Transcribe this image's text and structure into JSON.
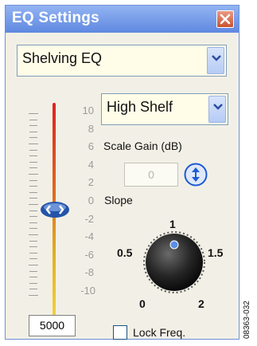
{
  "window": {
    "title": "EQ Settings",
    "close_icon": "close-icon"
  },
  "eq_type": {
    "value": "Shelving EQ"
  },
  "filter_type": {
    "value": "High Shelf"
  },
  "scale": {
    "labels": [
      "10",
      "8",
      "6",
      "4",
      "2",
      "0",
      "-2",
      "-4",
      "-6",
      "-8",
      "-10"
    ]
  },
  "frequency": {
    "value": "5000"
  },
  "scale_gain": {
    "label": "Scale Gain (dB)",
    "value": "0"
  },
  "slope": {
    "label": "Slope",
    "marks": {
      "top": "1",
      "left": "0.5",
      "right": "1.5",
      "bottom_left": "0",
      "bottom_right": "2"
    }
  },
  "lock_freq": {
    "label": "Lock Freq.",
    "checked": false
  },
  "figure_code": "08363-032",
  "colors": {
    "titlebar": "#5f88e0",
    "accent": "#1d5bd3",
    "slider_track_top": "#e02020",
    "slider_track_bottom": "#f0d040"
  }
}
